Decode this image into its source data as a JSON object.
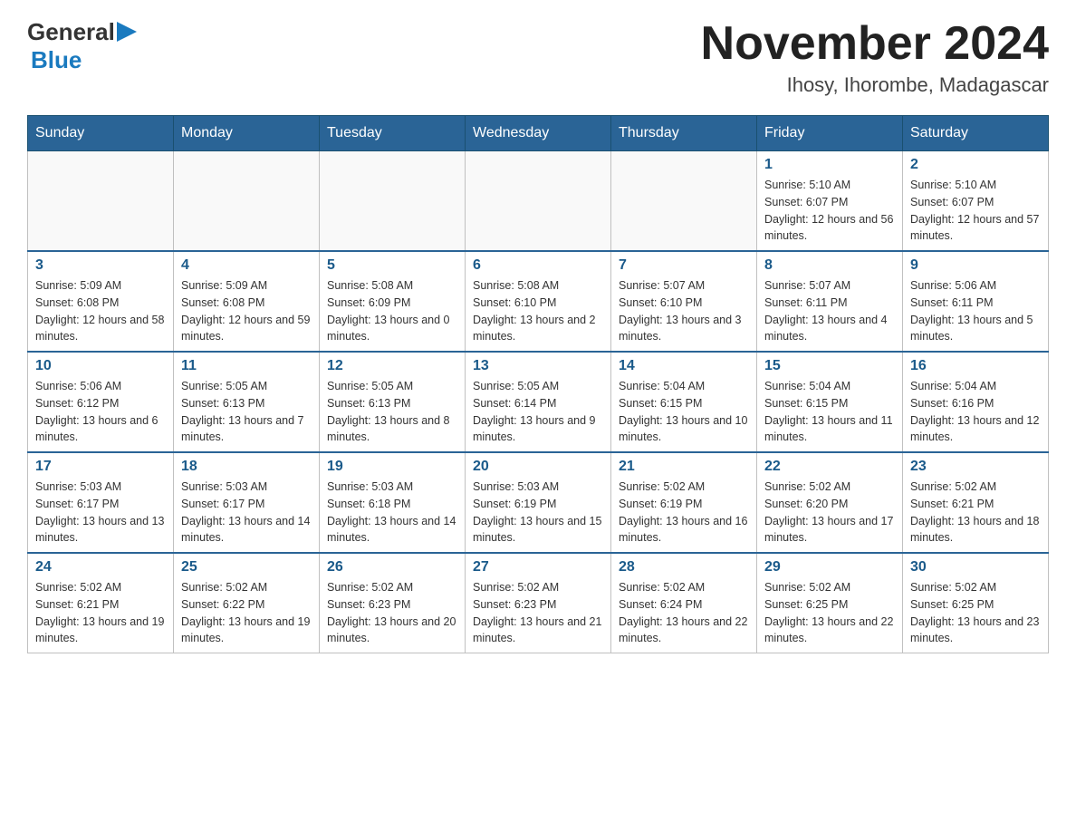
{
  "header": {
    "logo_general": "General",
    "logo_blue": "Blue",
    "month_title": "November 2024",
    "location": "Ihosy, Ihorombe, Madagascar"
  },
  "days_of_week": [
    "Sunday",
    "Monday",
    "Tuesday",
    "Wednesday",
    "Thursday",
    "Friday",
    "Saturday"
  ],
  "weeks": [
    [
      {
        "day": "",
        "info": ""
      },
      {
        "day": "",
        "info": ""
      },
      {
        "day": "",
        "info": ""
      },
      {
        "day": "",
        "info": ""
      },
      {
        "day": "",
        "info": ""
      },
      {
        "day": "1",
        "info": "Sunrise: 5:10 AM\nSunset: 6:07 PM\nDaylight: 12 hours and 56 minutes."
      },
      {
        "day": "2",
        "info": "Sunrise: 5:10 AM\nSunset: 6:07 PM\nDaylight: 12 hours and 57 minutes."
      }
    ],
    [
      {
        "day": "3",
        "info": "Sunrise: 5:09 AM\nSunset: 6:08 PM\nDaylight: 12 hours and 58 minutes."
      },
      {
        "day": "4",
        "info": "Sunrise: 5:09 AM\nSunset: 6:08 PM\nDaylight: 12 hours and 59 minutes."
      },
      {
        "day": "5",
        "info": "Sunrise: 5:08 AM\nSunset: 6:09 PM\nDaylight: 13 hours and 0 minutes."
      },
      {
        "day": "6",
        "info": "Sunrise: 5:08 AM\nSunset: 6:10 PM\nDaylight: 13 hours and 2 minutes."
      },
      {
        "day": "7",
        "info": "Sunrise: 5:07 AM\nSunset: 6:10 PM\nDaylight: 13 hours and 3 minutes."
      },
      {
        "day": "8",
        "info": "Sunrise: 5:07 AM\nSunset: 6:11 PM\nDaylight: 13 hours and 4 minutes."
      },
      {
        "day": "9",
        "info": "Sunrise: 5:06 AM\nSunset: 6:11 PM\nDaylight: 13 hours and 5 minutes."
      }
    ],
    [
      {
        "day": "10",
        "info": "Sunrise: 5:06 AM\nSunset: 6:12 PM\nDaylight: 13 hours and 6 minutes."
      },
      {
        "day": "11",
        "info": "Sunrise: 5:05 AM\nSunset: 6:13 PM\nDaylight: 13 hours and 7 minutes."
      },
      {
        "day": "12",
        "info": "Sunrise: 5:05 AM\nSunset: 6:13 PM\nDaylight: 13 hours and 8 minutes."
      },
      {
        "day": "13",
        "info": "Sunrise: 5:05 AM\nSunset: 6:14 PM\nDaylight: 13 hours and 9 minutes."
      },
      {
        "day": "14",
        "info": "Sunrise: 5:04 AM\nSunset: 6:15 PM\nDaylight: 13 hours and 10 minutes."
      },
      {
        "day": "15",
        "info": "Sunrise: 5:04 AM\nSunset: 6:15 PM\nDaylight: 13 hours and 11 minutes."
      },
      {
        "day": "16",
        "info": "Sunrise: 5:04 AM\nSunset: 6:16 PM\nDaylight: 13 hours and 12 minutes."
      }
    ],
    [
      {
        "day": "17",
        "info": "Sunrise: 5:03 AM\nSunset: 6:17 PM\nDaylight: 13 hours and 13 minutes."
      },
      {
        "day": "18",
        "info": "Sunrise: 5:03 AM\nSunset: 6:17 PM\nDaylight: 13 hours and 14 minutes."
      },
      {
        "day": "19",
        "info": "Sunrise: 5:03 AM\nSunset: 6:18 PM\nDaylight: 13 hours and 14 minutes."
      },
      {
        "day": "20",
        "info": "Sunrise: 5:03 AM\nSunset: 6:19 PM\nDaylight: 13 hours and 15 minutes."
      },
      {
        "day": "21",
        "info": "Sunrise: 5:02 AM\nSunset: 6:19 PM\nDaylight: 13 hours and 16 minutes."
      },
      {
        "day": "22",
        "info": "Sunrise: 5:02 AM\nSunset: 6:20 PM\nDaylight: 13 hours and 17 minutes."
      },
      {
        "day": "23",
        "info": "Sunrise: 5:02 AM\nSunset: 6:21 PM\nDaylight: 13 hours and 18 minutes."
      }
    ],
    [
      {
        "day": "24",
        "info": "Sunrise: 5:02 AM\nSunset: 6:21 PM\nDaylight: 13 hours and 19 minutes."
      },
      {
        "day": "25",
        "info": "Sunrise: 5:02 AM\nSunset: 6:22 PM\nDaylight: 13 hours and 19 minutes."
      },
      {
        "day": "26",
        "info": "Sunrise: 5:02 AM\nSunset: 6:23 PM\nDaylight: 13 hours and 20 minutes."
      },
      {
        "day": "27",
        "info": "Sunrise: 5:02 AM\nSunset: 6:23 PM\nDaylight: 13 hours and 21 minutes."
      },
      {
        "day": "28",
        "info": "Sunrise: 5:02 AM\nSunset: 6:24 PM\nDaylight: 13 hours and 22 minutes."
      },
      {
        "day": "29",
        "info": "Sunrise: 5:02 AM\nSunset: 6:25 PM\nDaylight: 13 hours and 22 minutes."
      },
      {
        "day": "30",
        "info": "Sunrise: 5:02 AM\nSunset: 6:25 PM\nDaylight: 13 hours and 23 minutes."
      }
    ]
  ]
}
